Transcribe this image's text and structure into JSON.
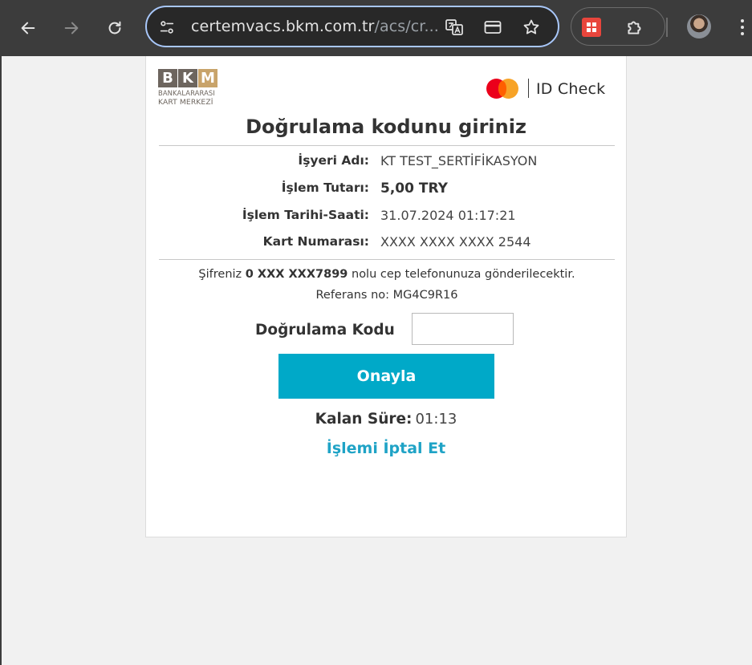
{
  "browser": {
    "url_host": "certemvacs.bkm.com.tr",
    "url_path": "/acs/cr..."
  },
  "brand": {
    "bkm_letters": [
      "B",
      "K",
      "M"
    ],
    "bkm_line1": "BANKALARARASI",
    "bkm_line2": "KART MERKEZİ",
    "id_check": "ID Check"
  },
  "page": {
    "title": "Doğrulama kodunu giriniz"
  },
  "info": [
    {
      "label": "İşyeri Adı:",
      "value": "KT TEST_SERTİFİKASYON"
    },
    {
      "label": "İşlem Tutarı:",
      "value": "5,00 TRY"
    },
    {
      "label": "İşlem Tarihi-Saati:",
      "value": "31.07.2024 01:17:21"
    },
    {
      "label": "Kart Numarası:",
      "value": "XXXX XXXX XXXX 2544"
    }
  ],
  "notice": {
    "prefix": "Şifreniz",
    "phone": "0 XXX XXX7899",
    "suffix": "nolu cep telefonunuza gönderilecektir.",
    "reference": "Referans no: MG4C9R16"
  },
  "form": {
    "code_label": "Doğrulama Kodu",
    "code_value": "",
    "submit_label": "Onayla"
  },
  "timer": {
    "label": "Kalan Süre:",
    "value": "01:13"
  },
  "cancel_label": "İşlemi İptal Et",
  "colors": {
    "accent": "#00a9c8",
    "link": "#1fa3c6",
    "bkm_dark": "#6d655e",
    "bkm_gold": "#c8a36a"
  }
}
